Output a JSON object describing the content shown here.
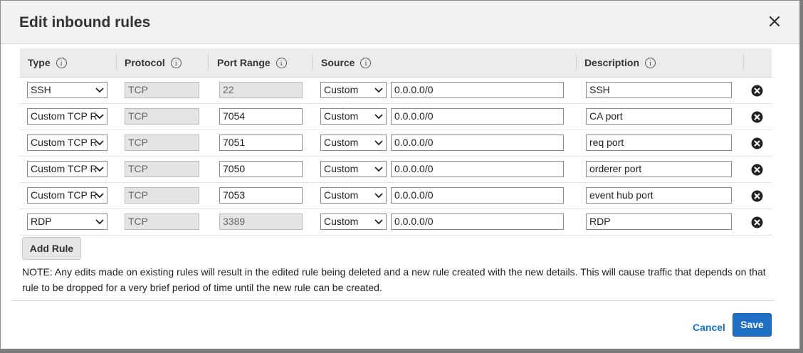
{
  "dialog": {
    "title": "Edit inbound rules",
    "close_icon": "close-icon"
  },
  "columns": {
    "type": "Type",
    "protocol": "Protocol",
    "port_range": "Port Range",
    "source": "Source",
    "description": "Description",
    "info_glyph": "i"
  },
  "rules": [
    {
      "type": "SSH",
      "protocol": "TCP",
      "port": "22",
      "port_editable": false,
      "source_type": "Custom",
      "source_value": "0.0.0.0/0",
      "description": "SSH"
    },
    {
      "type": "Custom TCP R",
      "protocol": "TCP",
      "port": "7054",
      "port_editable": true,
      "source_type": "Custom",
      "source_value": "0.0.0.0/0",
      "description": "CA port"
    },
    {
      "type": "Custom TCP R",
      "protocol": "TCP",
      "port": "7051",
      "port_editable": true,
      "source_type": "Custom",
      "source_value": "0.0.0.0/0",
      "description": "req port"
    },
    {
      "type": "Custom TCP R",
      "protocol": "TCP",
      "port": "7050",
      "port_editable": true,
      "source_type": "Custom",
      "source_value": "0.0.0.0/0",
      "description": "orderer port"
    },
    {
      "type": "Custom TCP R",
      "protocol": "TCP",
      "port": "7053",
      "port_editable": true,
      "source_type": "Custom",
      "source_value": "0.0.0.0/0",
      "description": "event hub port"
    },
    {
      "type": "RDP",
      "protocol": "TCP",
      "port": "3389",
      "port_editable": false,
      "source_type": "Custom",
      "source_value": "0.0.0.0/0",
      "description": "RDP"
    }
  ],
  "actions": {
    "add_rule": "Add Rule",
    "cancel": "Cancel",
    "save": "Save"
  },
  "note": "NOTE: Any edits made on existing rules will result in the edited rule being deleted and a new rule created with the new details. This will cause traffic that depends on that rule to be dropped for a very brief period of time until the new rule can be created.",
  "colors": {
    "primary": "#1f6fc5",
    "link": "#1a73c9",
    "header_bg": "#f2f2f2"
  }
}
